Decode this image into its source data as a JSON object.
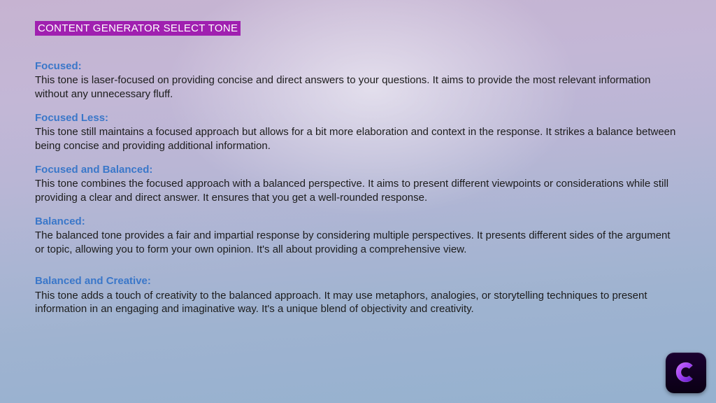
{
  "title": "CONTENT GENERATOR SELECT TONE",
  "sections": [
    {
      "heading": "Focused:",
      "body": "This tone is laser-focused on providing concise and direct answers to your questions. It aims to provide the most relevant information without any unnecessary fluff."
    },
    {
      "heading": "Focused Less:",
      "body": "This tone still maintains a focused approach but allows for a bit more elaboration and context in the response. It strikes a balance between being concise and providing additional information."
    },
    {
      "heading": "Focused and Balanced:",
      "body": "This tone combines the focused approach with a balanced perspective. It aims to present different viewpoints or considerations while still providing a clear and direct answer. It ensures that you get a well-rounded response."
    },
    {
      "heading": "Balanced:",
      "body": "The balanced tone provides a fair and impartial response by considering multiple perspectives. It presents different sides of the argument or topic, allowing you to form your own opinion. It's all about providing a comprehensive view."
    },
    {
      "heading": "Balanced and Creative:",
      "body": "This tone adds a touch of creativity to the balanced approach. It may use metaphors, analogies, or storytelling techniques to present information in an engaging and imaginative way. It's a unique blend of objectivity and creativity."
    }
  ],
  "logo": {
    "name": "app-logo"
  }
}
